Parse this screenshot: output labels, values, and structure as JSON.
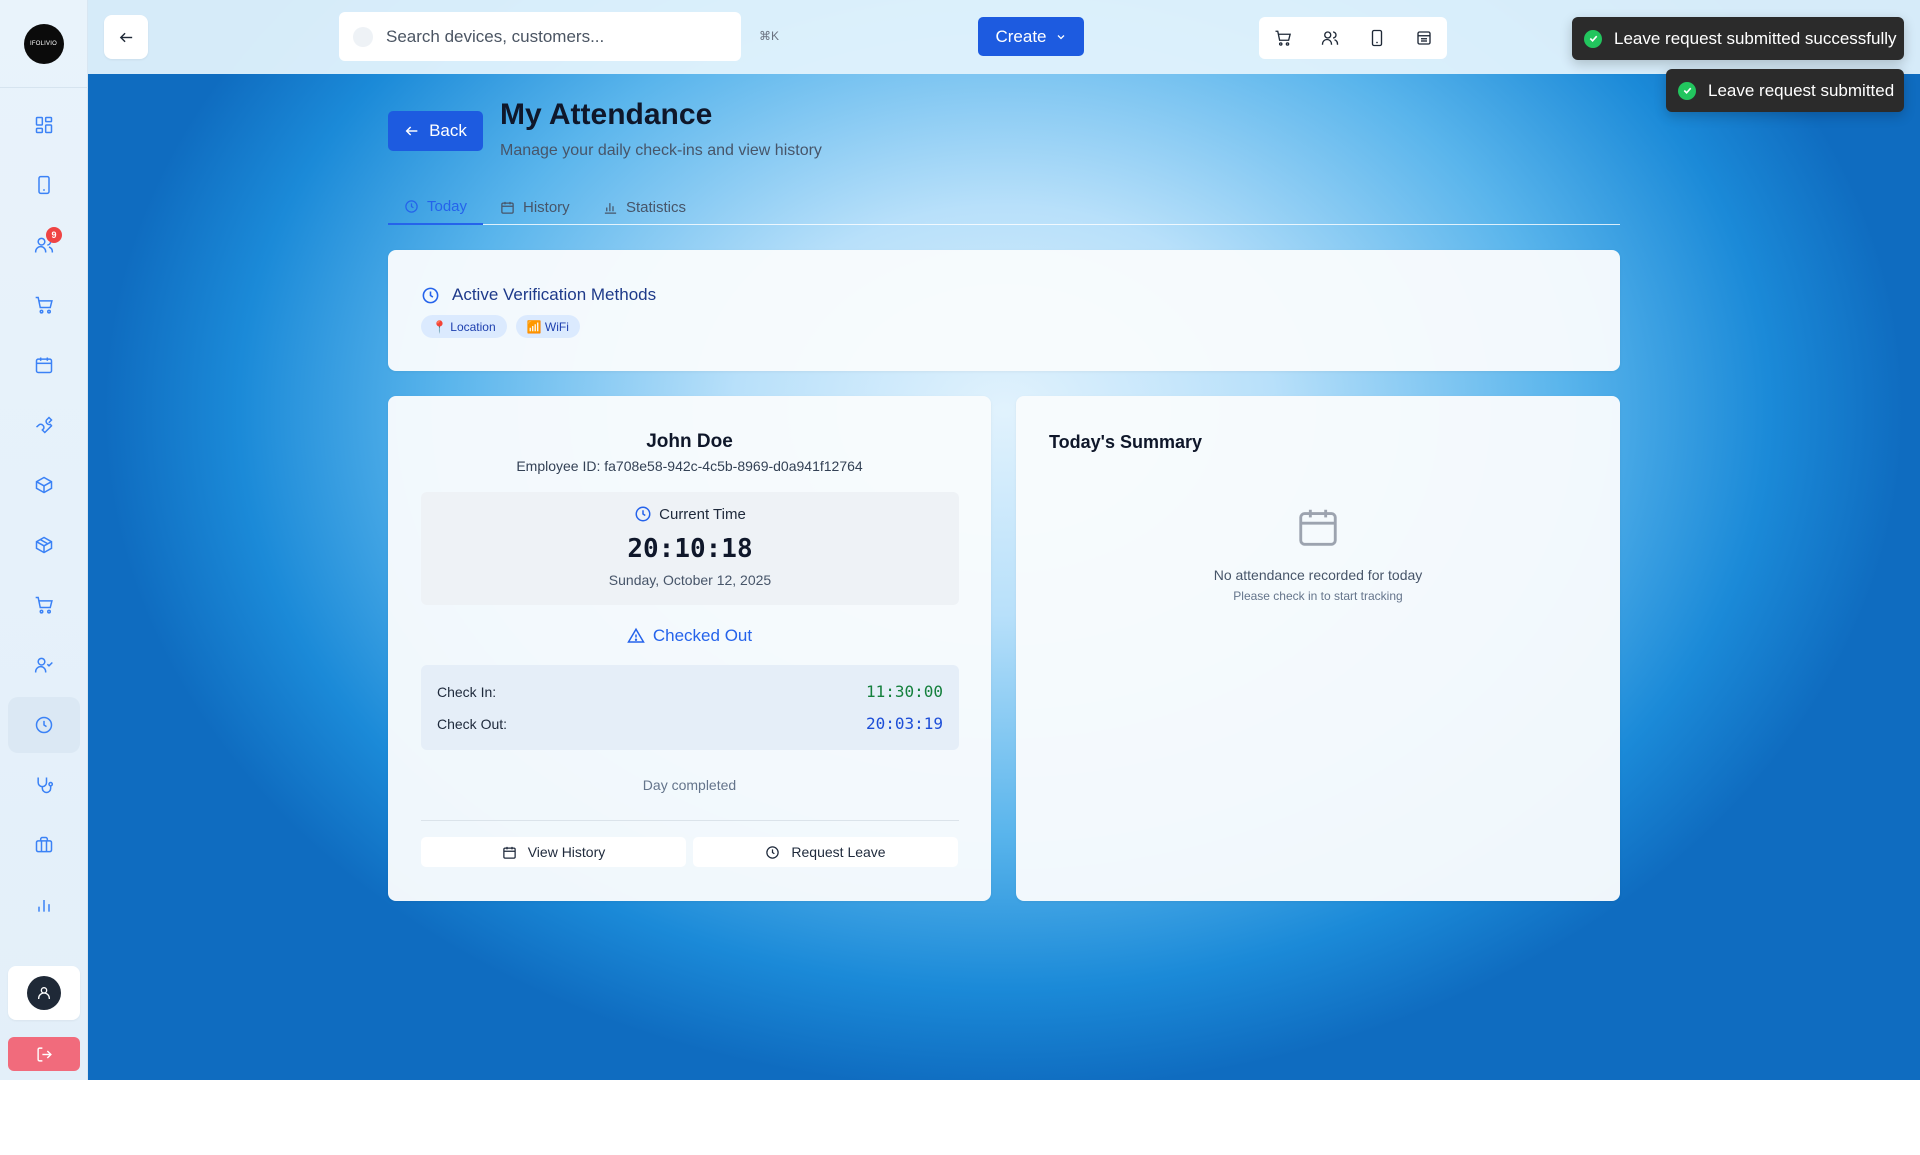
{
  "sidebar": {
    "logo_text": "IFOLIVIO",
    "nav_items": [
      {
        "icon": "dashboard-icon",
        "badge": ""
      },
      {
        "icon": "device-icon",
        "badge": ""
      },
      {
        "icon": "customers-icon",
        "badge": "9"
      },
      {
        "icon": "cart-icon",
        "badge": ""
      },
      {
        "icon": "calendar-icon",
        "badge": ""
      },
      {
        "icon": "wrench-icon",
        "badge": ""
      },
      {
        "icon": "package-icon",
        "badge": ""
      },
      {
        "icon": "package-alt-icon",
        "badge": ""
      },
      {
        "icon": "cart-alt-icon",
        "badge": ""
      },
      {
        "icon": "user-check-icon",
        "badge": ""
      },
      {
        "icon": "clock-icon",
        "badge": ""
      },
      {
        "icon": "stethoscope-icon",
        "badge": ""
      },
      {
        "icon": "briefcase-icon",
        "badge": ""
      },
      {
        "icon": "bar-chart-icon",
        "badge": ""
      }
    ]
  },
  "topbar": {
    "search_placeholder": "Search devices, customers...",
    "shortcut": "⌘K",
    "create_label": "Create"
  },
  "toasts": [
    {
      "message": "Leave request submitted successfully"
    },
    {
      "message": "Leave request submitted"
    }
  ],
  "page": {
    "back_label": "Back",
    "title": "My Attendance",
    "subtitle": "Manage your daily check-ins and view history"
  },
  "tabs": [
    {
      "label": "Today",
      "active": true
    },
    {
      "label": "History",
      "active": false
    },
    {
      "label": "Statistics",
      "active": false
    }
  ],
  "verification": {
    "title": "Active Verification Methods",
    "methods": [
      "📍 Location",
      "📶 WiFi"
    ]
  },
  "attendance": {
    "name": "John Doe",
    "employee_id": "Employee ID: fa708e58-942c-4c5b-8969-d0a941f12764",
    "current_time_label": "Current Time",
    "current_time": "20:10:18",
    "date": "Sunday, October 12, 2025",
    "status": "Checked Out",
    "check_in_label": "Check In:",
    "check_in": "11:30:00",
    "check_out_label": "Check Out:",
    "check_out": "20:03:19",
    "day_status": "Day completed",
    "view_history_label": "View History",
    "request_leave_label": "Request Leave"
  },
  "summary": {
    "title": "Today's Summary",
    "empty_text": "No attendance recorded for today",
    "empty_sub": "Please check in to start tracking"
  },
  "colors": {
    "primary": "#1d5be0",
    "accent_blue": "#2563eb",
    "check_in_green": "#15803d",
    "toast_bg": "#2b2b2b",
    "toast_check": "#22c55e",
    "badge_red": "#ef4444",
    "logout_red": "#f16b7c"
  }
}
